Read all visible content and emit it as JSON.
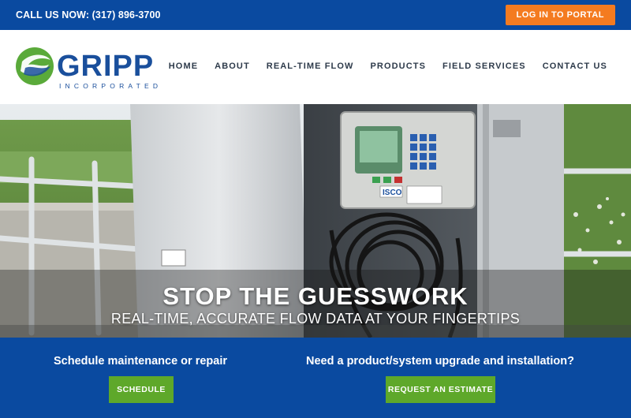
{
  "topbar": {
    "call_label": "CALL US NOW: (317) 896-3700",
    "portal_label": "LOG IN TO PORTAL"
  },
  "logo": {
    "name": "GRIPP",
    "tagline": "INCORPORATED"
  },
  "nav": {
    "items": [
      "HOME",
      "ABOUT",
      "REAL-TIME FLOW",
      "PRODUCTS",
      "FIELD SERVICES",
      "CONTACT US"
    ]
  },
  "hero": {
    "title": "STOP THE GUESSWORK",
    "subtitle": "REAL-TIME, ACCURATE FLOW DATA AT YOUR FINGERTIPS",
    "device_brand": "ISCO"
  },
  "cta": {
    "left": {
      "heading": "Schedule maintenance or repair",
      "button": "SCHEDULE"
    },
    "right": {
      "heading": "Need a product/system upgrade and installation?",
      "button": "REQUEST AN ESTIMATE"
    }
  },
  "colors": {
    "brand_blue": "#0a4aa0",
    "accent_orange": "#f47b20",
    "accent_green": "#5ea82a",
    "logo_green": "#5aaa3a",
    "logo_blue": "#1a4f9c"
  }
}
